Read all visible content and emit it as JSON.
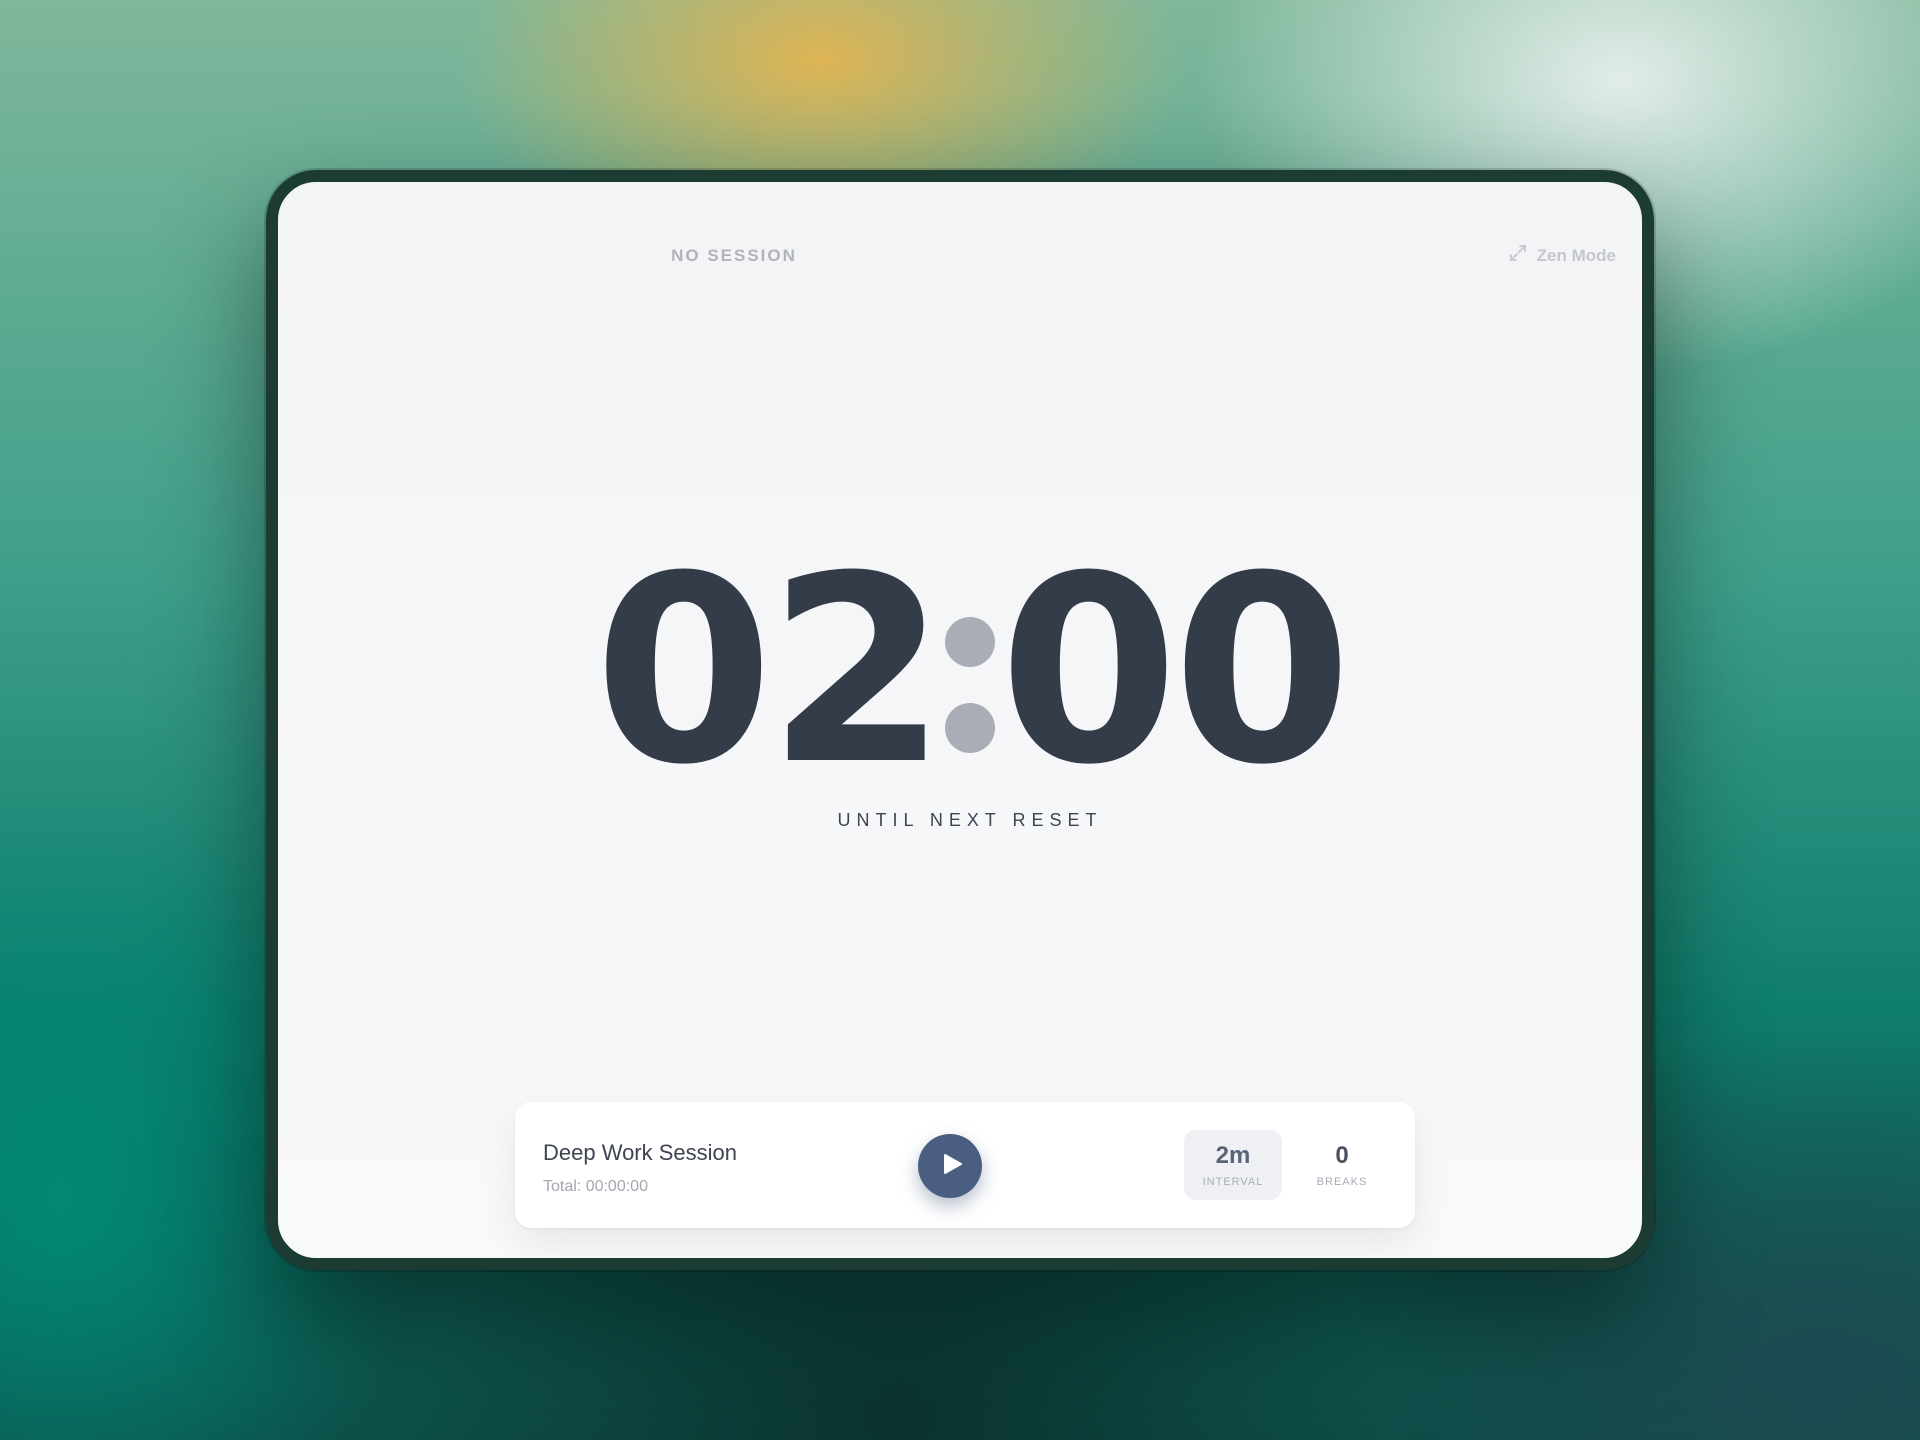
{
  "header": {
    "session_status": "NO SESSION",
    "zen_mode_label": "Zen Mode",
    "zen_mode_icon": "expand-icon"
  },
  "timer": {
    "minutes": "02",
    "seconds": "00",
    "caption": "UNTIL NEXT RESET"
  },
  "session": {
    "name": "Deep Work Session",
    "total": "Total: 00:00:00",
    "play_icon": "play-icon"
  },
  "stats": {
    "interval_value": "2m",
    "interval_label": "INTERVAL",
    "breaks_value": "0",
    "breaks_label": "BREAKS"
  },
  "colors": {
    "digits": "#343c4a",
    "colon": "#a9adb6",
    "play_button": "#4a5e82",
    "device_frame": "#1c3b33"
  }
}
